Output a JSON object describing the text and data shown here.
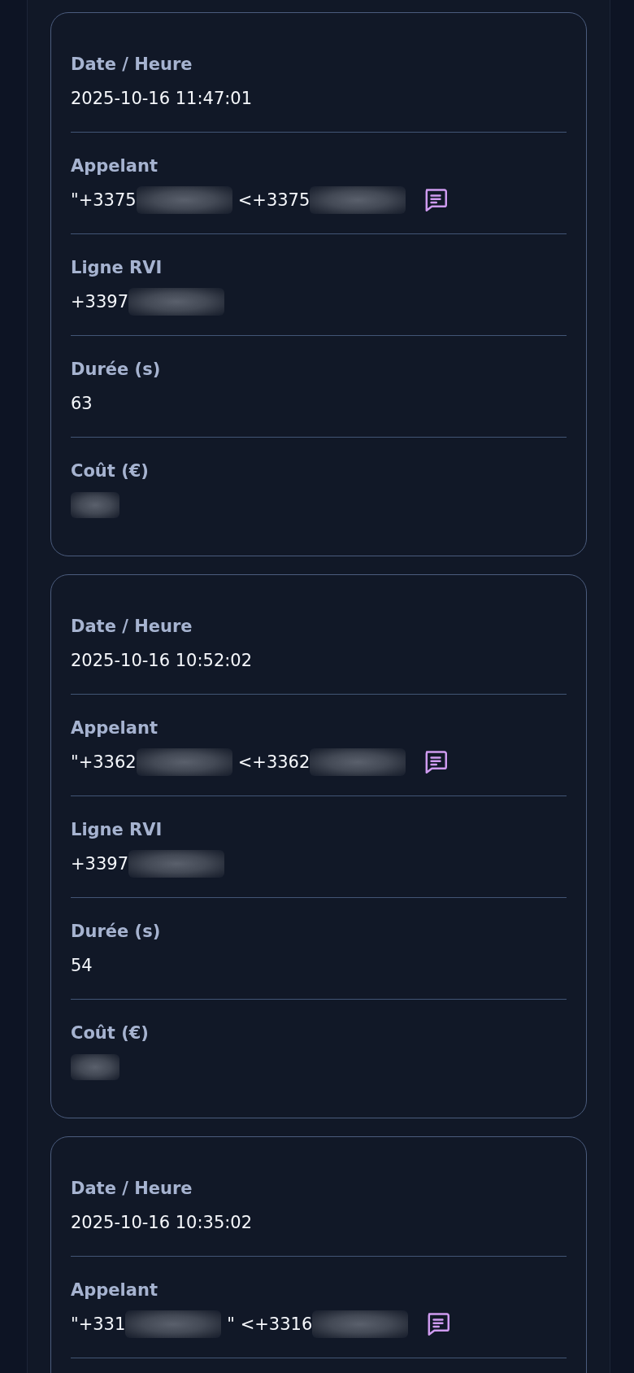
{
  "cards": [
    {
      "cut_off": false,
      "fields": [
        {
          "kind": "text",
          "label": "Date / Heure",
          "parts": [
            {
              "text": "2025-10-16 11:47:01",
              "redacted": false
            }
          ]
        },
        {
          "kind": "caller",
          "label": "Appelant",
          "message": true,
          "parts": [
            {
              "text": "\"+3375",
              "redacted": true
            },
            {
              "text": "<+3375",
              "redacted": true
            }
          ]
        },
        {
          "kind": "text",
          "label": "Ligne RVI",
          "parts": [
            {
              "text": "+3397",
              "redacted": true
            }
          ]
        },
        {
          "kind": "text",
          "label": "Durée (s)",
          "parts": [
            {
              "text": "63",
              "redacted": false
            }
          ]
        },
        {
          "kind": "amount",
          "label": "Coût (€)",
          "parts": [
            {
              "redacted": true
            }
          ]
        }
      ]
    },
    {
      "cut_off": false,
      "fields": [
        {
          "kind": "text",
          "label": "Date / Heure",
          "parts": [
            {
              "text": "2025-10-16 10:52:02",
              "redacted": false
            }
          ]
        },
        {
          "kind": "caller",
          "label": "Appelant",
          "message": true,
          "parts": [
            {
              "text": "\"+3362",
              "redacted": true
            },
            {
              "text": "<+3362",
              "redacted": true
            }
          ]
        },
        {
          "kind": "text",
          "label": "Ligne RVI",
          "parts": [
            {
              "text": "+3397",
              "redacted": true
            }
          ]
        },
        {
          "kind": "text",
          "label": "Durée (s)",
          "parts": [
            {
              "text": "54",
              "redacted": false
            }
          ]
        },
        {
          "kind": "amount",
          "label": "Coût (€)",
          "parts": [
            {
              "redacted": true
            }
          ]
        }
      ]
    },
    {
      "cut_off": true,
      "fields": [
        {
          "kind": "text",
          "label": "Date / Heure",
          "parts": [
            {
              "text": "2025-10-16 10:35:02",
              "redacted": false
            }
          ]
        },
        {
          "kind": "caller",
          "label": "Appelant",
          "message": true,
          "parts": [
            {
              "text": "\"+331",
              "redacted": true
            },
            {
              "text": "\" <+3316",
              "redacted": true
            }
          ]
        }
      ]
    }
  ]
}
